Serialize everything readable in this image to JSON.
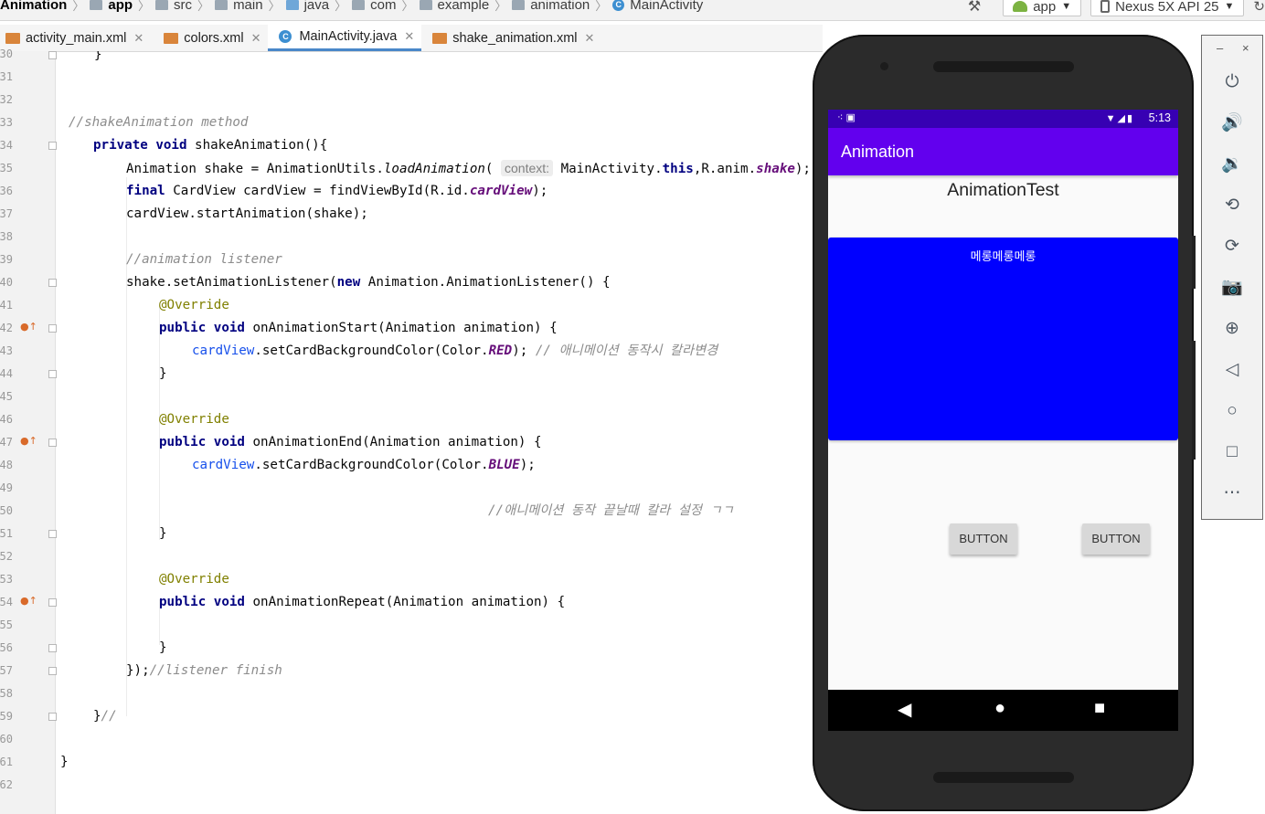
{
  "breadcrumb": [
    {
      "label": "Animation",
      "bold": true
    },
    {
      "label": "app",
      "bold": true,
      "icon": "folder"
    },
    {
      "label": "src",
      "icon": "folder"
    },
    {
      "label": "main",
      "icon": "folder"
    },
    {
      "label": "java",
      "icon": "folder"
    },
    {
      "label": "com",
      "icon": "folder"
    },
    {
      "label": "example",
      "icon": "folder"
    },
    {
      "label": "animation",
      "icon": "folder"
    },
    {
      "label": "MainActivity",
      "icon": "class"
    }
  ],
  "toolbar": {
    "run_config": "app",
    "device": "Nexus 5X API 25"
  },
  "tabs": [
    {
      "label": "activity_main.xml",
      "icon": "xml-file-icon",
      "active": false
    },
    {
      "label": "colors.xml",
      "icon": "xml-file-icon",
      "active": false
    },
    {
      "label": "MainActivity.java",
      "icon": "java-class-icon",
      "active": true
    },
    {
      "label": "shake_animation.xml",
      "icon": "xml-file-icon",
      "active": false
    }
  ],
  "editor": {
    "line_numbers": [
      "30",
      "31",
      "32",
      "33",
      "34",
      "35",
      "36",
      "37",
      "38",
      "39",
      "40",
      "41",
      "42",
      "43",
      "44",
      "45",
      "46",
      "47",
      "48",
      "49",
      "50",
      "51",
      "52",
      "53",
      "54",
      "55",
      "56",
      "57",
      "58",
      "59",
      "60",
      "61",
      "62"
    ],
    "code": {
      "l30": "}",
      "l33": "//shakeAnimation method",
      "l34_kw": "private void",
      "l34": " shakeAnimation(){",
      "l35_a": "Animation shake = AnimationUtils.",
      "l35_m": "loadAnimation",
      "l35_b": "( ",
      "l35_hint": "context:",
      "l35_c": " MainActivity.",
      "l35_this": "this",
      "l35_d": ",R.anim.",
      "l35_f": "shake",
      "l35_e": ");",
      "l36_kw": "final",
      "l36_a": " CardView cardView = findViewById(R.id.",
      "l36_f": "cardView",
      "l36_b": ");",
      "l37": "cardView.startAnimation(shake);",
      "l39": "//animation listener",
      "l40_a": "shake.setAnimationListener(",
      "l40_kw": "new",
      "l40_b": " Animation.AnimationListener() {",
      "l41": "@Override",
      "l42_kw": "public void",
      "l42": " onAnimationStart(Animation animation) {",
      "l43_v": "cardView",
      "l43_a": ".setCardBackgroundColor(Color.",
      "l43_f": "RED",
      "l43_b": "); ",
      "l43_c": "// 애니메이션 동작시 칼라변경",
      "l44": "}",
      "l46": "@Override",
      "l47_kw": "public void",
      "l47": " onAnimationEnd(Animation animation) {",
      "l48_v": "cardView",
      "l48_a": ".setCardBackgroundColor(Color.",
      "l48_f": "BLUE",
      "l48_b": ");",
      "l50": "//애니메이션 동작 끝날때 칼라 설정 ㄱㄱ",
      "l51": "}",
      "l53": "@Override",
      "l54_kw": "public void",
      "l54": " onAnimationRepeat(Animation animation) {",
      "l56": "}",
      "l57_a": "});",
      "l57_c": "//listener finish",
      "l59_a": "}",
      "l59_c": "//",
      "l61": "}"
    }
  },
  "emulator": {
    "status_time": "5:13",
    "app_title": "Animation",
    "content_title": "AnimationTest",
    "card_text": "메롱메롱메롱",
    "button1": "BUTTON",
    "button2": "BUTTON",
    "card_color": "#0000ff",
    "appbar_color": "#6200ee",
    "statusbar_color": "#3700b3"
  },
  "emulator_panel": {
    "minimize": "–",
    "close": "×",
    "controls": [
      "power-icon",
      "volume-up-icon",
      "volume-down-icon",
      "rotate-left-icon",
      "rotate-right-icon",
      "camera-icon",
      "zoom-icon",
      "back-icon",
      "home-icon",
      "overview-icon",
      "more-icon"
    ]
  }
}
